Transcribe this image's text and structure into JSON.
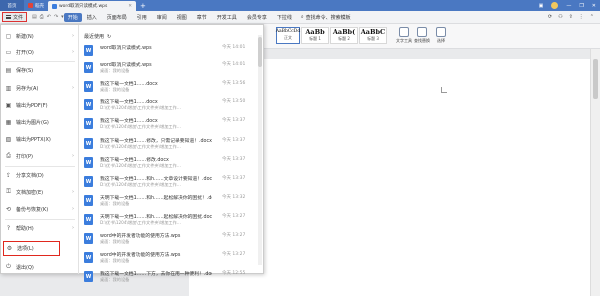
{
  "titlebar": {
    "home": "首页",
    "tabs": [
      {
        "label": "稻壳",
        "icon": "docer-icon",
        "color": "#e0443a"
      },
      {
        "label": "word取消只读模式.wps",
        "icon": "wps-doc-icon",
        "color": "#3b7ddd"
      }
    ],
    "plus": "+"
  },
  "menubar": {
    "file": "文件",
    "items": [
      "开始",
      "插入",
      "页面布局",
      "引用",
      "审阅",
      "视图",
      "章节",
      "开发工具",
      "会员专享",
      "下拉线"
    ],
    "active_index": 0,
    "search": "查找命令、搜索模板"
  },
  "ribbon": {
    "styles": [
      {
        "big": "AaBbCcDd",
        "label": "正文"
      },
      {
        "big": "AaBb",
        "label": "标题 1"
      },
      {
        "big": "AaBb(",
        "label": "标题 2"
      },
      {
        "big": "AaBbC",
        "label": "标题 3"
      }
    ],
    "buttons": {
      "text_tools": "文字工具",
      "find_replace": "查找替换",
      "select": "选择"
    }
  },
  "file_menu": {
    "items": [
      {
        "label": "新建(N)",
        "icon": "new-file-icon",
        "arrow": true
      },
      {
        "label": "打开(O)",
        "icon": "open-folder-icon",
        "arrow": true
      },
      {
        "label": "保存(S)",
        "icon": "save-icon",
        "arrow": false
      },
      {
        "label": "另存为(A)",
        "icon": "save-as-icon",
        "arrow": true
      },
      {
        "label": "输出为PDF(F)",
        "icon": "pdf-icon",
        "arrow": false
      },
      {
        "label": "输出为图片(G)",
        "icon": "image-icon",
        "arrow": false
      },
      {
        "label": "输出为PPTX(X)",
        "icon": "pptx-icon",
        "arrow": false
      },
      {
        "label": "打印(P)",
        "icon": "print-icon",
        "arrow": true
      },
      {
        "label": "分享文档(D)",
        "icon": "share-icon",
        "arrow": false
      },
      {
        "label": "文档加密(E)",
        "icon": "lock-icon",
        "arrow": true
      },
      {
        "label": "备份与恢复(K)",
        "icon": "backup-icon",
        "arrow": true
      },
      {
        "label": "帮助(H)",
        "icon": "help-icon",
        "arrow": true
      },
      {
        "label": "选项(L)",
        "icon": "gear-icon",
        "arrow": false
      },
      {
        "label": "退出(Q)",
        "icon": "exit-icon",
        "arrow": false
      }
    ],
    "recent_header": "最近使用",
    "recent": [
      {
        "name": "word取消只读模式.wps",
        "path": "",
        "time": "今天 14:01",
        "type": "wps"
      },
      {
        "name": "word取消只读模式.wps",
        "path": "桌面：我的设备",
        "time": "今天 14:01",
        "type": "wps"
      },
      {
        "name": "我这下载一文档1……docx",
        "path": "桌面：我的设备",
        "time": "今天 13:56",
        "type": "docx"
      },
      {
        "name": "我这下载一文档1……docx",
        "path": "D:\\优书\\1204\\增加\\工作文件夹\\增加工作…",
        "time": "今天 13:50",
        "type": "docx"
      },
      {
        "name": "我这下载一文档1……docx",
        "path": "D:\\优书\\1204\\增加\\工作文件夹\\增加工作…",
        "time": "今天 13:37",
        "type": "docx"
      },
      {
        "name": "我这下载一文档1……修改，只需记录要知道！.docx",
        "path": "D:\\优书\\1204\\增加\\工作文件夹\\增加工作…",
        "time": "今天 13:37",
        "type": "docx"
      },
      {
        "name": "我这下载一文档1……修改.docx",
        "path": "D:\\优书\\1204\\增加\\工作文件夹\\增加工作…",
        "time": "今天 13:37",
        "type": "docx"
      },
      {
        "name": "我这下载一文档1……和h……文章设计要知道！.docx",
        "path": "D:\\优书\\1204\\增加\\工作文件夹\\增加工作…",
        "time": "今天 13:37",
        "type": "docx"
      },
      {
        "name": "天明下载一文档1……和h……起松解决你的困扰！.docx",
        "path": "桌面：我的设备",
        "time": "今天 13:32",
        "type": "docx"
      },
      {
        "name": "天明下载一文档1……和h……起松解决你的困扰.docx",
        "path": "D:\\优书\\1204\\增加\\工作文件夹\\增加工作…",
        "time": "今天 13:27",
        "type": "docx"
      },
      {
        "name": "word中的开发者功能的使用方法.wps",
        "path": "桌面：我的设备",
        "time": "今天 13:27",
        "type": "wps"
      },
      {
        "name": "word中的开发者功能的使用方法.wps",
        "path": "桌面：我的设备",
        "time": "今天 13:27",
        "type": "wps"
      },
      {
        "name": "我这下载一文档1……下方，去你在用一种便利！.docx",
        "path": "桌面：我的设备",
        "time": "今天 12:55",
        "type": "docx"
      }
    ]
  }
}
